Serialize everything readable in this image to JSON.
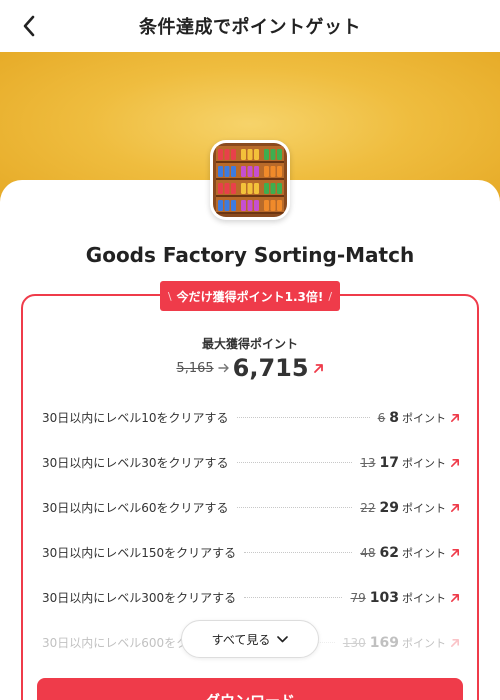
{
  "header": {
    "title": "条件達成でポイントゲット",
    "back_icon": "chevron-left-icon"
  },
  "app": {
    "name": "Goods Factory Sorting-Match",
    "icon": "goods-factory-app-icon"
  },
  "promo": {
    "text": "今だけ獲得ポイント1.3倍!",
    "deco_left": "\\",
    "deco_right": "/"
  },
  "max_points": {
    "label": "最大獲得ポイント",
    "old": "5,165",
    "new": "6,715"
  },
  "tasks": [
    {
      "label": "30日以内にレベル10をクリアする",
      "old": "6",
      "new": "8",
      "unit": "ポイント"
    },
    {
      "label": "30日以内にレベル30をクリアする",
      "old": "13",
      "new": "17",
      "unit": "ポイント"
    },
    {
      "label": "30日以内にレベル60をクリアする",
      "old": "22",
      "new": "29",
      "unit": "ポイント"
    },
    {
      "label": "30日以内にレベル150をクリアする",
      "old": "48",
      "new": "62",
      "unit": "ポイント"
    },
    {
      "label": "30日以内にレベル300をクリアする",
      "old": "79",
      "new": "103",
      "unit": "ポイント"
    },
    {
      "label": "30日以内にレベル600をクリアする",
      "old": "130",
      "new": "169",
      "unit": "ポイント"
    }
  ],
  "see_all": {
    "label": "すべて見る"
  },
  "download": {
    "label": "ダウンロード"
  },
  "colors": {
    "accent": "#ef3b4a",
    "banner": "#efbd3f"
  }
}
